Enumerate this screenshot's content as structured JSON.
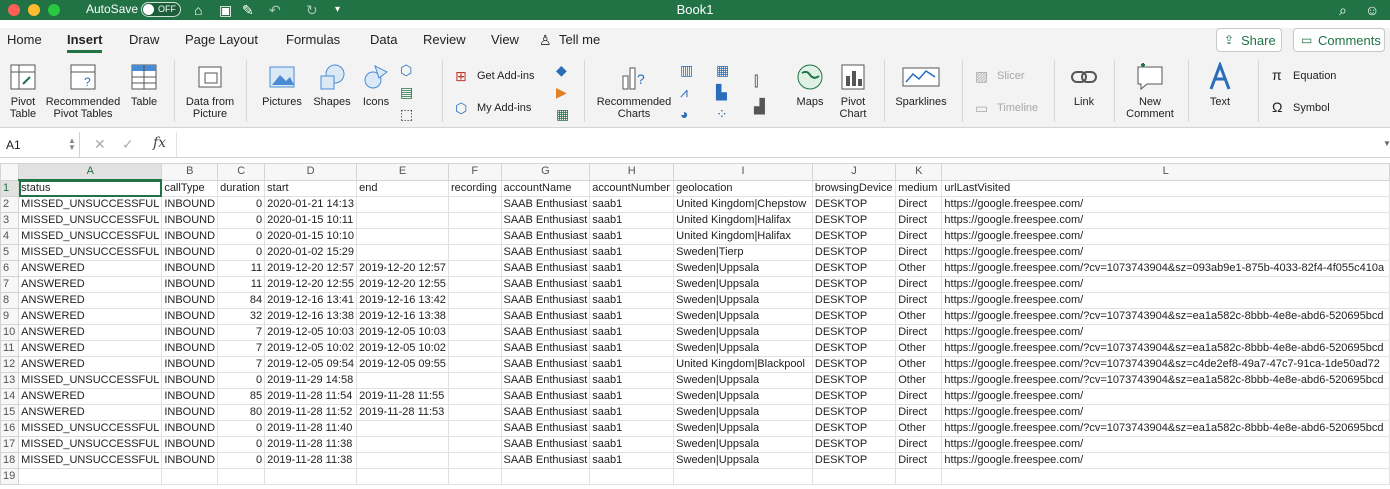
{
  "window": {
    "title": "Book1",
    "autosave_label": "AutoSave",
    "autosave_state": "OFF"
  },
  "tabs": [
    "Home",
    "Insert",
    "Draw",
    "Page Layout",
    "Formulas",
    "Data",
    "Review",
    "View",
    "Tell me"
  ],
  "active_tab": "Insert",
  "header_buttons": {
    "share": "Share",
    "comments": "Comments"
  },
  "ribbon": {
    "pivot_table": "Pivot Table",
    "recommended_pivot": "Recommended Pivot Tables",
    "table": "Table",
    "data_from_picture": "Data from Picture",
    "pictures": "Pictures",
    "shapes": "Shapes",
    "icons": "Icons",
    "get_addins": "Get Add-ins",
    "my_addins": "My Add-ins",
    "recommended_charts": "Recommended Charts",
    "maps": "Maps",
    "pivot_chart": "Pivot Chart",
    "sparklines": "Sparklines",
    "slicer": "Slicer",
    "timeline": "Timeline",
    "link": "Link",
    "new_comment": "New Comment",
    "text": "Text",
    "equation": "Equation",
    "symbol": "Symbol"
  },
  "formula_bar": {
    "name_box": "A1",
    "fx": "fx",
    "formula": ""
  },
  "colors": {
    "accent": "#217346",
    "titlebar": "#217346"
  },
  "sheet": {
    "columns": [
      "A",
      "B",
      "C",
      "D",
      "E",
      "F",
      "G",
      "H",
      "I",
      "J",
      "K",
      "L"
    ],
    "selected_cell": "A1",
    "rows": [
      [
        "status",
        "callType",
        "duration",
        "start",
        "end",
        "recording",
        "accountName",
        "accountNumber",
        "geolocation",
        "browsingDevice",
        "medium",
        "urlLastVisited"
      ],
      [
        "MISSED_UNSUCCESSFUL",
        "INBOUND",
        "0",
        "2020-01-21 14:13",
        "",
        "",
        "SAAB Enthusiast",
        "saab1",
        "United Kingdom|Chepstow",
        "DESKTOP",
        "Direct",
        "https://google.freespee.com/"
      ],
      [
        "MISSED_UNSUCCESSFUL",
        "INBOUND",
        "0",
        "2020-01-15 10:11",
        "",
        "",
        "SAAB Enthusiast",
        "saab1",
        "United Kingdom|Halifax",
        "DESKTOP",
        "Direct",
        "https://google.freespee.com/"
      ],
      [
        "MISSED_UNSUCCESSFUL",
        "INBOUND",
        "0",
        "2020-01-15 10:10",
        "",
        "",
        "SAAB Enthusiast",
        "saab1",
        "United Kingdom|Halifax",
        "DESKTOP",
        "Direct",
        "https://google.freespee.com/"
      ],
      [
        "MISSED_UNSUCCESSFUL",
        "INBOUND",
        "0",
        "2020-01-02 15:29",
        "",
        "",
        "SAAB Enthusiast",
        "saab1",
        "Sweden|Tierp",
        "DESKTOP",
        "Direct",
        "https://google.freespee.com/"
      ],
      [
        "ANSWERED",
        "INBOUND",
        "11",
        "2019-12-20 12:57",
        "2019-12-20 12:57",
        "",
        "SAAB Enthusiast",
        "saab1",
        "Sweden|Uppsala",
        "DESKTOP",
        "Other",
        "https://google.freespee.com/?cv=1073743904&sz=093ab9e1-875b-4033-82f4-4f055c410a"
      ],
      [
        "ANSWERED",
        "INBOUND",
        "11",
        "2019-12-20 12:55",
        "2019-12-20 12:55",
        "",
        "SAAB Enthusiast",
        "saab1",
        "Sweden|Uppsala",
        "DESKTOP",
        "Direct",
        "https://google.freespee.com/"
      ],
      [
        "ANSWERED",
        "INBOUND",
        "84",
        "2019-12-16 13:41",
        "2019-12-16 13:42",
        "",
        "SAAB Enthusiast",
        "saab1",
        "Sweden|Uppsala",
        "DESKTOP",
        "Direct",
        "https://google.freespee.com/"
      ],
      [
        "ANSWERED",
        "INBOUND",
        "32",
        "2019-12-16 13:38",
        "2019-12-16 13:38",
        "",
        "SAAB Enthusiast",
        "saab1",
        "Sweden|Uppsala",
        "DESKTOP",
        "Other",
        "https://google.freespee.com/?cv=1073743904&sz=ea1a582c-8bbb-4e8e-abd6-520695bcd"
      ],
      [
        "ANSWERED",
        "INBOUND",
        "7",
        "2019-12-05 10:03",
        "2019-12-05 10:03",
        "",
        "SAAB Enthusiast",
        "saab1",
        "Sweden|Uppsala",
        "DESKTOP",
        "Direct",
        "https://google.freespee.com/"
      ],
      [
        "ANSWERED",
        "INBOUND",
        "7",
        "2019-12-05 10:02",
        "2019-12-05 10:02",
        "",
        "SAAB Enthusiast",
        "saab1",
        "Sweden|Uppsala",
        "DESKTOP",
        "Other",
        "https://google.freespee.com/?cv=1073743904&sz=ea1a582c-8bbb-4e8e-abd6-520695bcd"
      ],
      [
        "ANSWERED",
        "INBOUND",
        "7",
        "2019-12-05 09:54",
        "2019-12-05 09:55",
        "",
        "SAAB Enthusiast",
        "saab1",
        "United Kingdom|Blackpool",
        "DESKTOP",
        "Other",
        "https://google.freespee.com/?cv=1073743904&sz=c4de2ef8-49a7-47c7-91ca-1de50ad72"
      ],
      [
        "MISSED_UNSUCCESSFUL",
        "INBOUND",
        "0",
        "2019-11-29 14:58",
        "",
        "",
        "SAAB Enthusiast",
        "saab1",
        "Sweden|Uppsala",
        "DESKTOP",
        "Other",
        "https://google.freespee.com/?cv=1073743904&sz=ea1a582c-8bbb-4e8e-abd6-520695bcd"
      ],
      [
        "ANSWERED",
        "INBOUND",
        "85",
        "2019-11-28 11:54",
        "2019-11-28 11:55",
        "",
        "SAAB Enthusiast",
        "saab1",
        "Sweden|Uppsala",
        "DESKTOP",
        "Direct",
        "https://google.freespee.com/"
      ],
      [
        "ANSWERED",
        "INBOUND",
        "80",
        "2019-11-28 11:52",
        "2019-11-28 11:53",
        "",
        "SAAB Enthusiast",
        "saab1",
        "Sweden|Uppsala",
        "DESKTOP",
        "Direct",
        "https://google.freespee.com/"
      ],
      [
        "MISSED_UNSUCCESSFUL",
        "INBOUND",
        "0",
        "2019-11-28 11:40",
        "",
        "",
        "SAAB Enthusiast",
        "saab1",
        "Sweden|Uppsala",
        "DESKTOP",
        "Other",
        "https://google.freespee.com/?cv=1073743904&sz=ea1a582c-8bbb-4e8e-abd6-520695bcd"
      ],
      [
        "MISSED_UNSUCCESSFUL",
        "INBOUND",
        "0",
        "2019-11-28 11:38",
        "",
        "",
        "SAAB Enthusiast",
        "saab1",
        "Sweden|Uppsala",
        "DESKTOP",
        "Direct",
        "https://google.freespee.com/"
      ],
      [
        "MISSED_UNSUCCESSFUL",
        "INBOUND",
        "0",
        "2019-11-28 11:38",
        "",
        "",
        "SAAB Enthusiast",
        "saab1",
        "Sweden|Uppsala",
        "DESKTOP",
        "Direct",
        "https://google.freespee.com/"
      ],
      [
        "",
        "",
        "",
        "",
        "",
        "",
        "",
        "",
        "",
        "",
        "",
        ""
      ]
    ]
  }
}
